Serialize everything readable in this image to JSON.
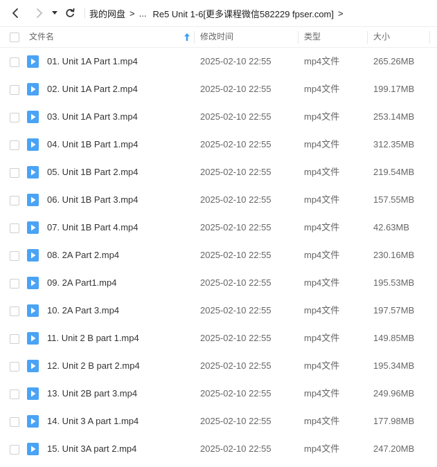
{
  "toolbar": {
    "breadcrumb_root": "我的网盘",
    "breadcrumb_ellipsis": "...",
    "breadcrumb_current": "Re5 Unit 1-6[更多课程微信582229 fpser.com]",
    "separator": ">"
  },
  "table": {
    "columns": {
      "name": "文件名",
      "modified": "修改时间",
      "type": "类型",
      "size": "大小"
    },
    "rows": [
      {
        "name": "01. Unit 1A Part 1.mp4",
        "modified": "2025-02-10 22:55",
        "type": "mp4文件",
        "size": "265.26MB"
      },
      {
        "name": "02. Unit 1A Part 2.mp4",
        "modified": "2025-02-10 22:55",
        "type": "mp4文件",
        "size": "199.17MB"
      },
      {
        "name": "03. Unit 1A Part 3.mp4",
        "modified": "2025-02-10 22:55",
        "type": "mp4文件",
        "size": "253.14MB"
      },
      {
        "name": "04. Unit 1B Part 1.mp4",
        "modified": "2025-02-10 22:55",
        "type": "mp4文件",
        "size": "312.35MB"
      },
      {
        "name": "05. Unit 1B Part 2.mp4",
        "modified": "2025-02-10 22:55",
        "type": "mp4文件",
        "size": "219.54MB"
      },
      {
        "name": "06. Unit 1B Part 3.mp4",
        "modified": "2025-02-10 22:55",
        "type": "mp4文件",
        "size": "157.55MB"
      },
      {
        "name": "07. Unit 1B Part 4.mp4",
        "modified": "2025-02-10 22:55",
        "type": "mp4文件",
        "size": "42.63MB"
      },
      {
        "name": "08. 2A Part 2.mp4",
        "modified": "2025-02-10 22:55",
        "type": "mp4文件",
        "size": "230.16MB"
      },
      {
        "name": "09. 2A Part1.mp4",
        "modified": "2025-02-10 22:55",
        "type": "mp4文件",
        "size": "195.53MB"
      },
      {
        "name": "10. 2A Part 3.mp4",
        "modified": "2025-02-10 22:55",
        "type": "mp4文件",
        "size": "197.57MB"
      },
      {
        "name": "11. Unit 2 B part 1.mp4",
        "modified": "2025-02-10 22:55",
        "type": "mp4文件",
        "size": "149.85MB"
      },
      {
        "name": "12. Unit 2 B part 2.mp4",
        "modified": "2025-02-10 22:55",
        "type": "mp4文件",
        "size": "195.34MB"
      },
      {
        "name": "13. Unit 2B part 3.mp4",
        "modified": "2025-02-10 22:55",
        "type": "mp4文件",
        "size": "249.96MB"
      },
      {
        "name": "14. Unit 3 A part 1.mp4",
        "modified": "2025-02-10 22:55",
        "type": "mp4文件",
        "size": "177.98MB"
      },
      {
        "name": "15. Unit 3A part 2.mp4",
        "modified": "2025-02-10 22:55",
        "type": "mp4文件",
        "size": "247.20MB"
      }
    ]
  },
  "colors": {
    "accent": "#3a9bf4",
    "file_icon": "#4aa3f5",
    "text": "#333333",
    "muted": "#666666"
  },
  "icons": {
    "back": "chevron-left-icon",
    "forward": "chevron-right-icon",
    "dropdown": "caret-down-icon",
    "refresh": "refresh-icon",
    "sort": "sort-ascending-icon",
    "file": "video-file-icon"
  }
}
